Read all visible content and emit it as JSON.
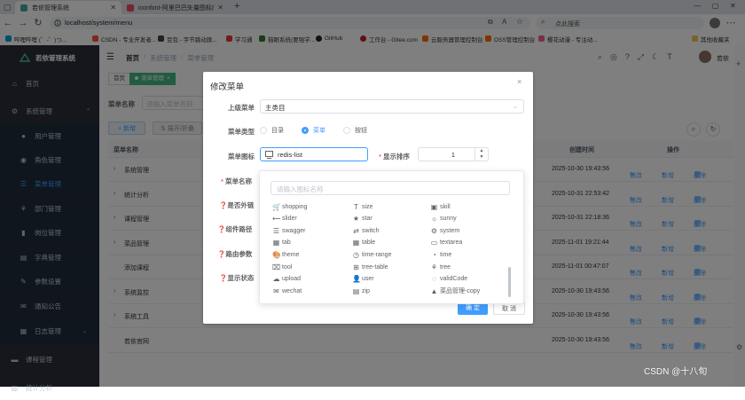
{
  "browser": {
    "tabs": [
      {
        "title": "若依管理系统",
        "active": true
      },
      {
        "title": "iconfont-阿里巴巴矢量图标库",
        "active": false
      }
    ],
    "new_tab": "+",
    "url": "localhost/system/menu",
    "search_placeholder": "点此搜索",
    "bookmarks": [
      "哔哩哔哩 (゜-゜)つ...",
      "CSDN - 专业开发者...",
      "豆包 - 字节跳动旗...",
      "学习通",
      "猫眼系统(要强学...",
      "GitHub",
      "工作台 - Gitee.com",
      "云服务器管理控制台",
      "OSS管理控制台",
      "樱花动漫 - 专注动..."
    ],
    "other_favorites": "其他收藏夹"
  },
  "sidebar": {
    "logo_text": "若依管理系统",
    "items": [
      {
        "label": "首页",
        "level": "top"
      },
      {
        "label": "系统管理",
        "level": "top",
        "expanded": true
      },
      {
        "label": "用户管理",
        "level": "sub"
      },
      {
        "label": "角色管理",
        "level": "sub"
      },
      {
        "label": "菜单管理",
        "level": "sub",
        "active": true
      },
      {
        "label": "部门管理",
        "level": "sub"
      },
      {
        "label": "岗位管理",
        "level": "sub"
      },
      {
        "label": "字典管理",
        "level": "sub"
      },
      {
        "label": "参数设置",
        "level": "sub"
      },
      {
        "label": "通知公告",
        "level": "sub"
      },
      {
        "label": "日志管理",
        "level": "sub"
      },
      {
        "label": "课程管理",
        "level": "top"
      },
      {
        "label": "统计分析",
        "level": "top"
      }
    ]
  },
  "header": {
    "breadcrumb": [
      "首页",
      "系统管理",
      "菜单管理"
    ],
    "username": "若依"
  },
  "tags": [
    "首页",
    "菜单管理"
  ],
  "search_form": {
    "menu_name_label": "菜单名称",
    "menu_name_placeholder": "请输入菜单名称"
  },
  "toolbar": {
    "add_label": "+ 新增",
    "expand_label": "展开/折叠"
  },
  "table": {
    "headers": [
      "菜单名称",
      "创建时间",
      "操作"
    ],
    "rows": [
      {
        "name": "系统管理",
        "time": "2025-10-30 19:43:56",
        "expandable": true
      },
      {
        "name": "统计分析",
        "time": "2025-10-31 22:53:42",
        "expandable": true
      },
      {
        "name": "课程管理",
        "time": "2025-10-31 22:18:36",
        "expandable": true
      },
      {
        "name": "菜品管理",
        "time": "2025-11-01 19:21:44",
        "expandable": true
      },
      {
        "name": "添加课程",
        "time": "2025-11-01 00:47:07",
        "expandable": false
      },
      {
        "name": "系统监控",
        "time": "2025-10-30 19:43:56",
        "expandable": true
      },
      {
        "name": "系统工具",
        "time": "2025-10-30 19:43:56",
        "expandable": true
      },
      {
        "name": "若依官网",
        "time": "2025-10-30 19:43:56",
        "expandable": false
      }
    ],
    "ops": {
      "edit": "修改",
      "add": "新增",
      "delete": "删除"
    }
  },
  "dialog": {
    "title": "修改菜单",
    "parent_label": "上级菜单",
    "parent_value": "主类目",
    "type_label": "菜单类型",
    "type_options": [
      "目录",
      "菜单",
      "按钮"
    ],
    "type_selected": "菜单",
    "icon_label": "菜单图标",
    "icon_value": "redis-list",
    "order_label": "显示排序",
    "order_value": "1",
    "name_label": "菜单名称",
    "external_label": "是否外链",
    "path_label": "组件路径",
    "params_label": "路由参数",
    "status_label": "显示状态",
    "confirm_label": "确 定",
    "cancel_label": "取 消"
  },
  "icon_picker": {
    "placeholder": "请输入图标名称",
    "icons": [
      {
        "name": "shopping",
        "glyph": "🛒"
      },
      {
        "name": "size",
        "glyph": "T"
      },
      {
        "name": "skill",
        "glyph": "▣"
      },
      {
        "name": "slider",
        "glyph": "⟷"
      },
      {
        "name": "star",
        "glyph": "★"
      },
      {
        "name": "sunny",
        "glyph": "☼"
      },
      {
        "name": "swagger",
        "glyph": "☰"
      },
      {
        "name": "switch",
        "glyph": "⇄"
      },
      {
        "name": "system",
        "glyph": "⚙"
      },
      {
        "name": "tab",
        "glyph": "▦"
      },
      {
        "name": "table",
        "glyph": "▦"
      },
      {
        "name": "textarea",
        "glyph": "▭"
      },
      {
        "name": "theme",
        "glyph": "🎨"
      },
      {
        "name": "time-range",
        "glyph": "◷"
      },
      {
        "name": "time",
        "glyph": "◔"
      },
      {
        "name": "tool",
        "glyph": "⌧"
      },
      {
        "name": "tree-table",
        "glyph": "⊞"
      },
      {
        "name": "tree",
        "glyph": "⚘"
      },
      {
        "name": "upload",
        "glyph": "☁"
      },
      {
        "name": "user",
        "glyph": "👤"
      },
      {
        "name": "validCode",
        "glyph": "◌"
      },
      {
        "name": "wechat",
        "glyph": "✉"
      },
      {
        "name": "zip",
        "glyph": "▤"
      },
      {
        "name": "菜品管理-copy",
        "glyph": "▲"
      }
    ]
  },
  "watermark": "CSDN @十八旬"
}
